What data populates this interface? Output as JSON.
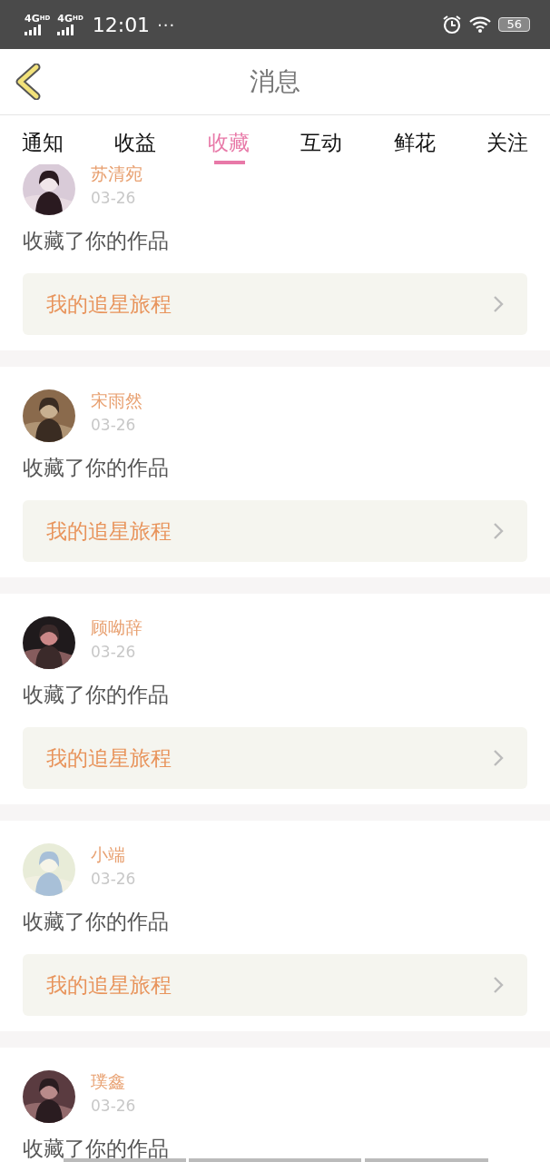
{
  "status_bar": {
    "networks": [
      {
        "label": "4G",
        "sup": "HD"
      },
      {
        "label": "4G",
        "sup": "HD"
      }
    ],
    "time": "12:01",
    "more": "···",
    "battery": "56"
  },
  "header": {
    "title": "消息"
  },
  "tabs": [
    {
      "label": "通知",
      "selected": false
    },
    {
      "label": "收益",
      "selected": false
    },
    {
      "label": "收藏",
      "selected": true
    },
    {
      "label": "互动",
      "selected": false
    },
    {
      "label": "鲜花",
      "selected": false
    },
    {
      "label": "关注",
      "selected": false
    }
  ],
  "messages": [
    {
      "name": "苏清宛",
      "date": "03-26",
      "text": "收藏了你的作品",
      "work": "我的追星旅程"
    },
    {
      "name": "宋雨然",
      "date": "03-26",
      "text": "收藏了你的作品",
      "work": "我的追星旅程"
    },
    {
      "name": "顾呦辞",
      "date": "03-26",
      "text": "收藏了你的作品",
      "work": "我的追星旅程"
    },
    {
      "name": "小端",
      "date": "03-26",
      "text": "收藏了你的作品",
      "work": "我的追星旅程"
    },
    {
      "name": "璞鑫",
      "date": "03-26",
      "text": "收藏了你的作品"
    }
  ]
}
